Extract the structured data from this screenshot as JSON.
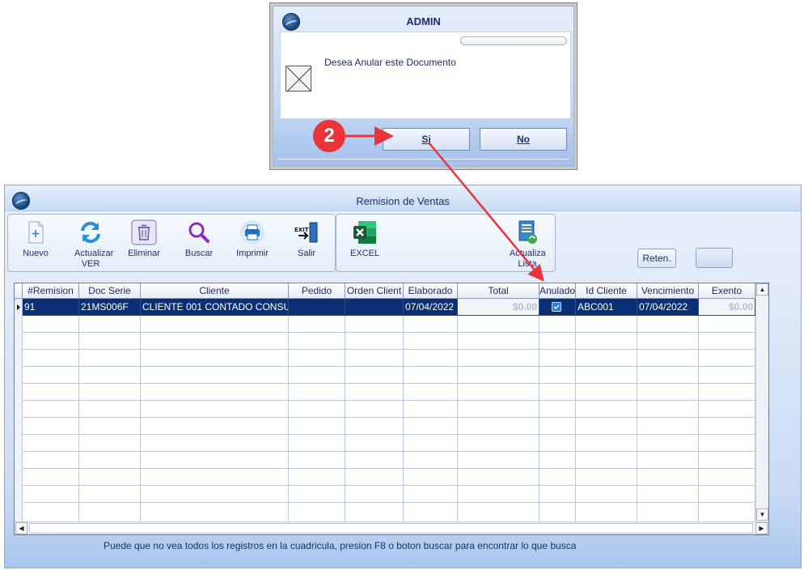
{
  "main": {
    "title": "Remision de Ventas",
    "toolbar": [
      {
        "label": "Nuevo",
        "icon": "new-document-icon"
      },
      {
        "label": "Actualizar VER",
        "icon": "refresh-icon"
      },
      {
        "label": "Eliminar",
        "icon": "trash-icon"
      },
      {
        "label": "Buscar",
        "icon": "search-icon"
      },
      {
        "label": "Imprimir",
        "icon": "printer-icon"
      },
      {
        "label": "Salir",
        "icon": "exit-icon"
      }
    ],
    "toolbar2": [
      {
        "label": "EXCEL",
        "icon": "excel-icon"
      },
      {
        "label": "Actualiza Lista",
        "icon": "update-list-icon"
      }
    ],
    "reten_label": "Reten.",
    "hint": "Puede que no vea todos los registros en la cuadricula, presion F8 o boton buscar para encontrar lo que busca"
  },
  "grid": {
    "columns": [
      "#Remision",
      "Doc Serie",
      "Cliente",
      "Pedido",
      "Orden Client",
      "Elaborado",
      "Total",
      "Anulado",
      "Id Cliente",
      "Vencimiento",
      "Exento"
    ],
    "rows": [
      {
        "remision": "91",
        "doc_serie": "21MS006F",
        "cliente": "CLIENTE 001 CONTADO CONSU",
        "pedido": "",
        "orden_client": "",
        "elaborado": "07/04/2022",
        "total": "$0.00",
        "anulado": true,
        "id_cliente": "ABC001",
        "vencimiento": "07/04/2022",
        "exento": "$0.00"
      }
    ]
  },
  "dialog": {
    "title": "ADMIN",
    "message": "Desea Anular este Documento",
    "yes_label": "Si",
    "no_label": "No"
  },
  "annotation": {
    "step_number": "2",
    "color": "#e8353b"
  }
}
